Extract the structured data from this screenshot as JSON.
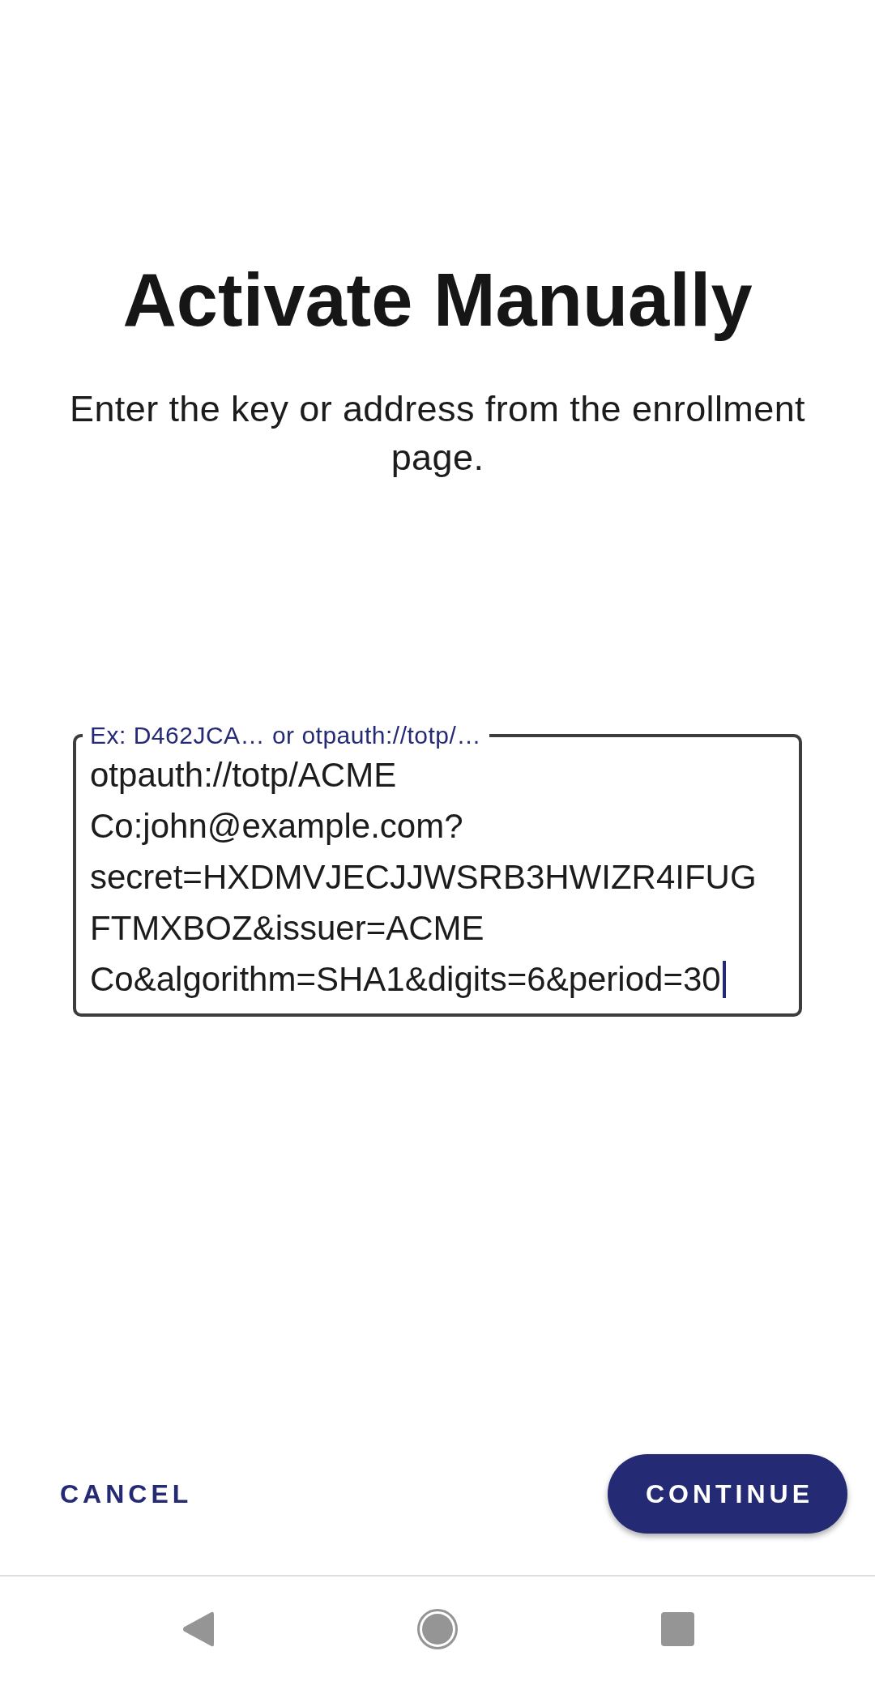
{
  "title": "Activate Manually",
  "subtitle": "Enter the key or address from the enrollment page.",
  "field": {
    "label": "Ex: D462JCA… or otpauth://totp/…",
    "value": "otpauth://totp/ACME Co:john@example.com?secret=HXDMVJECJJWSRB3HWIZR4IFUGFTMXBOZ&issuer=ACME Co&algorithm=SHA1&digits=6&period=30",
    "focused": true
  },
  "actions": [
    {
      "label": "CANCEL",
      "kind": "text"
    },
    {
      "label": "CONTINUE",
      "kind": "filled"
    }
  ]
}
